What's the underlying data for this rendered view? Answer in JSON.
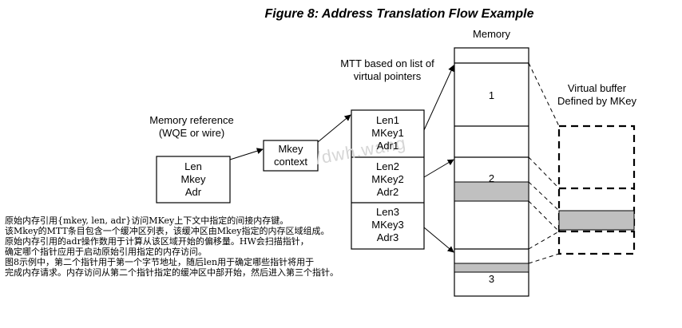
{
  "title": "Figure 8: Address Translation Flow Example",
  "labels": {
    "memory": "Memory",
    "mtt_line1": "MTT based on list of",
    "mtt_line2": "virtual pointers",
    "memref_line1": "Memory reference",
    "memref_line2": "(WQE or wire)",
    "vbuf_line1": "Virtual buffer",
    "vbuf_line2": "Defined by MKey"
  },
  "memory_reference_box": [
    "Len",
    "Mkey",
    "Adr"
  ],
  "mkey_context_box": [
    "Mkey",
    "context"
  ],
  "mtt_entries": [
    [
      "Len1",
      "MKey1",
      "Adr1"
    ],
    [
      "Len2",
      "MKey2",
      "Adr2"
    ],
    [
      "Len3",
      "MKey3",
      "Adr3"
    ]
  ],
  "memory_region_labels": [
    "1",
    "2",
    "3"
  ],
  "caption_lines": [
    "原始内存引用{mkey, len, adr}访问MKey上下文中指定的间接内存键。",
    "该Mkey的MTT条目包含一个缓冲区列表，该缓冲区由Mkey指定的内存区域组成。",
    "原始内存引用的adr操作数用于计算从该区域开始的偏移量。HW会扫描指针，",
    "确定哪个指针应用于启动原始引用指定的内存访问。",
    "图8示例中，第二个指针用于第一个字节地址，随后len用于确定哪些指针将用于",
    "完成内存请求。内存访问从第二个指针指定的缓冲区中部开始，然后进入第三个指针。"
  ],
  "watermark": "/dwh.wang"
}
